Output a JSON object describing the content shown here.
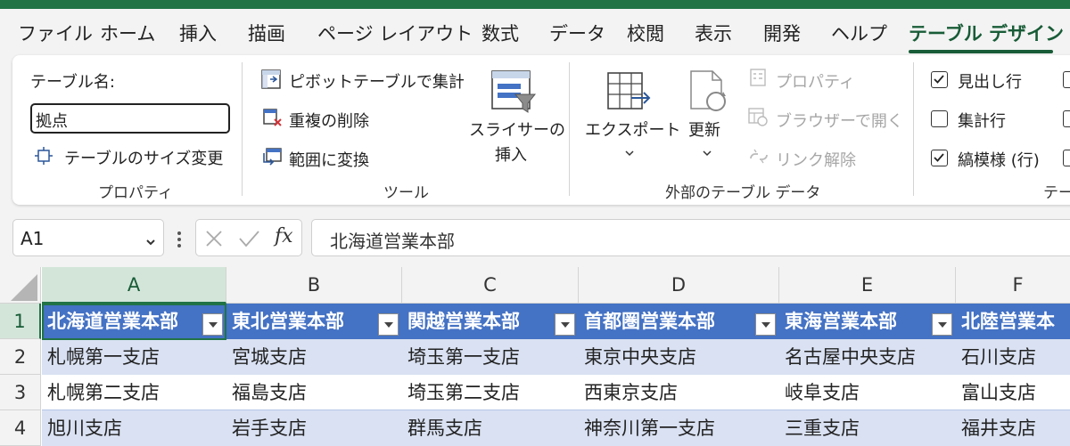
{
  "ribbon_tabs": [
    "ファイル",
    "ホーム",
    "挿入",
    "描画",
    "ページ レイアウト",
    "数式",
    "データ",
    "校閲",
    "表示",
    "開発",
    "ヘルプ",
    "テーブル デザイン"
  ],
  "active_tab": "テーブル デザイン",
  "properties": {
    "table_name_label": "テーブル名:",
    "table_name_value": "拠点",
    "resize_label": "テーブルのサイズ変更",
    "group_label": "プロパティ"
  },
  "tools": {
    "pivot_label": "ピボットテーブルで集計",
    "remove_dup_label": "重複の削除",
    "convert_label": "範囲に変換",
    "slicer_line1": "スライサーの",
    "slicer_line2": "挿入",
    "group_label": "ツール"
  },
  "external": {
    "export_label": "エクスポート",
    "refresh_label": "更新",
    "properties_label": "プロパティ",
    "open_browser_label": "ブラウザーで開く",
    "unlink_label": "リンク解除",
    "group_label": "外部のテーブル データ"
  },
  "style_options": {
    "header_row_label": "見出し行",
    "total_row_label": "集計行",
    "banded_rows_label": "縞模様 (行)",
    "header_row_checked": true,
    "total_row_checked": false,
    "banded_rows_checked": true,
    "group_label": "テー"
  },
  "formula_bar": {
    "name_box": "A1",
    "fx": "fx",
    "formula": "北海道営業本部"
  },
  "columns": [
    "A",
    "B",
    "C",
    "D",
    "E",
    "F"
  ],
  "rows": [
    "1",
    "2",
    "3",
    "4"
  ],
  "table": {
    "headers": [
      "北海道営業本部",
      "東北営業本部",
      "関越営業本部",
      "首都圏営業本部",
      "東海営業本部",
      "北陸営業本"
    ],
    "data": [
      [
        "札幌第一支店",
        "宮城支店",
        "埼玉第一支店",
        "東京中央支店",
        "名古屋中央支店",
        "石川支店"
      ],
      [
        "札幌第二支店",
        "福島支店",
        "埼玉第二支店",
        "西東京支店",
        "岐阜支店",
        "富山支店"
      ],
      [
        "旭川支店",
        "岩手支店",
        "群馬支店",
        "神奈川第一支店",
        "三重支店",
        "福井支店"
      ]
    ]
  },
  "colors": {
    "accent": "#217346",
    "table_header": "#4472c4",
    "band": "#d9e1f2"
  }
}
